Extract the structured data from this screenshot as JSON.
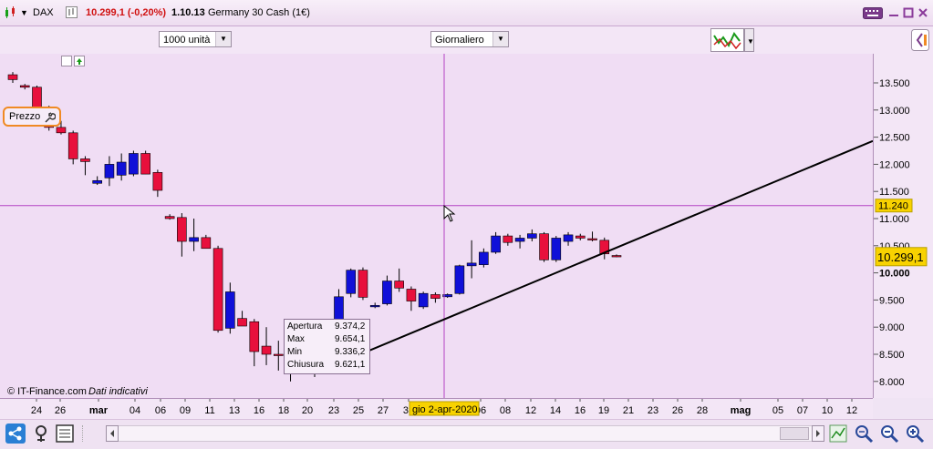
{
  "window": {
    "instrument": "DAX",
    "price_change": "10.299,1 (-0,20%)",
    "time": "1.10.13",
    "name": "Germany 30 Cash (1€)"
  },
  "toolbar": {
    "units_select": "1000 unità",
    "period_select": "Giornaliero"
  },
  "chart_panel": {
    "label": "Prezzo",
    "crosshair_price": "11.240",
    "current_price": "10.299,1",
    "crosshair_date": "gio 2-apr-2020",
    "source_credit": "© IT-Finance.com",
    "source_note": "Dati indicativi"
  },
  "tooltip": [
    {
      "key": "Apertura",
      "value": "9.374,2"
    },
    {
      "key": "Max",
      "value": "9.654,1"
    },
    {
      "key": "Min",
      "value": "9.336,2"
    },
    {
      "key": "Chiusura",
      "value": "9.621,1"
    }
  ],
  "colors": {
    "up": "#1010d8",
    "down": "#e8103c",
    "crosshair": "#b444c4",
    "price_tag": "#f8d200"
  },
  "chart_data": {
    "type": "candlestick",
    "ylim": [
      7700,
      14000
    ],
    "y_ticks": [
      "13.500",
      "13.000",
      "12.500",
      "12.000",
      "11.500",
      "11.000",
      "10.500",
      "10.000",
      "9.500",
      "9.000",
      "8.500",
      "8.000"
    ],
    "x_ticks": [
      "24",
      "26",
      "mar",
      "04",
      "06",
      "09",
      "11",
      "13",
      "16",
      "18",
      "20",
      "23",
      "25",
      "27",
      "30",
      "06",
      "08",
      "12",
      "14",
      "16",
      "19",
      "21",
      "23",
      "26",
      "28",
      "mag",
      "05",
      "07",
      "10",
      "12"
    ],
    "candles": [
      {
        "o": 13650,
        "h": 13700,
        "l": 13500,
        "c": 13560
      },
      {
        "o": 13450,
        "h": 13480,
        "l": 13380,
        "c": 13420
      },
      {
        "o": 13420,
        "h": 13450,
        "l": 13000,
        "c": 13030
      },
      {
        "o": 13030,
        "h": 13080,
        "l": 12620,
        "c": 12680
      },
      {
        "o": 12680,
        "h": 12800,
        "l": 12550,
        "c": 12580
      },
      {
        "o": 12580,
        "h": 12620,
        "l": 12000,
        "c": 12100
      },
      {
        "o": 12100,
        "h": 12150,
        "l": 11800,
        "c": 12050
      },
      {
        "o": 11650,
        "h": 11780,
        "l": 11620,
        "c": 11700
      },
      {
        "o": 11750,
        "h": 12150,
        "l": 11600,
        "c": 12000
      },
      {
        "o": 11800,
        "h": 12200,
        "l": 11700,
        "c": 12040
      },
      {
        "o": 11820,
        "h": 12250,
        "l": 11780,
        "c": 12200
      },
      {
        "o": 12200,
        "h": 12250,
        "l": 11820,
        "c": 11820
      },
      {
        "o": 11850,
        "h": 11900,
        "l": 11400,
        "c": 11520
      },
      {
        "o": 11040,
        "h": 11080,
        "l": 10980,
        "c": 11000
      },
      {
        "o": 11020,
        "h": 11100,
        "l": 10300,
        "c": 10580
      },
      {
        "o": 10580,
        "h": 11000,
        "l": 10400,
        "c": 10650
      },
      {
        "o": 10650,
        "h": 10700,
        "l": 10450,
        "c": 10450
      },
      {
        "o": 10450,
        "h": 10500,
        "l": 8900,
        "c": 8940
      },
      {
        "o": 8980,
        "h": 9820,
        "l": 8880,
        "c": 9650
      },
      {
        "o": 9160,
        "h": 9300,
        "l": 9020,
        "c": 9020
      },
      {
        "o": 9100,
        "h": 9150,
        "l": 8280,
        "c": 8550
      },
      {
        "o": 8650,
        "h": 9000,
        "l": 8300,
        "c": 8500
      },
      {
        "o": 8500,
        "h": 8750,
        "l": 8200,
        "c": 8480
      },
      {
        "o": 8480,
        "h": 8700,
        "l": 8000,
        "c": 8460
      },
      {
        "o": 8430,
        "h": 8500,
        "l": 8300,
        "c": 8470
      },
      {
        "o": 8200,
        "h": 8350,
        "l": 8080,
        "c": 8220
      },
      {
        "o": 8300,
        "h": 8760,
        "l": 8240,
        "c": 8620
      },
      {
        "o": 8980,
        "h": 9700,
        "l": 8920,
        "c": 9560
      },
      {
        "o": 9620,
        "h": 10080,
        "l": 9550,
        "c": 10050
      },
      {
        "o": 10050,
        "h": 10100,
        "l": 9500,
        "c": 9550
      },
      {
        "o": 9380,
        "h": 9450,
        "l": 9350,
        "c": 9400
      },
      {
        "o": 9430,
        "h": 9950,
        "l": 9400,
        "c": 9850
      },
      {
        "o": 9850,
        "h": 10080,
        "l": 9650,
        "c": 9720
      },
      {
        "o": 9700,
        "h": 9750,
        "l": 9300,
        "c": 9480
      },
      {
        "o": 9374,
        "h": 9654,
        "l": 9336,
        "c": 9621
      },
      {
        "o": 9600,
        "h": 9640,
        "l": 9450,
        "c": 9530
      },
      {
        "o": 9560,
        "h": 9620,
        "l": 9540,
        "c": 9600
      },
      {
        "o": 9620,
        "h": 10150,
        "l": 9600,
        "c": 10130
      },
      {
        "o": 10130,
        "h": 10600,
        "l": 9900,
        "c": 10180
      },
      {
        "o": 10150,
        "h": 10450,
        "l": 10100,
        "c": 10380
      },
      {
        "o": 10380,
        "h": 10750,
        "l": 10350,
        "c": 10680
      },
      {
        "o": 10680,
        "h": 10720,
        "l": 10500,
        "c": 10560
      },
      {
        "o": 10580,
        "h": 10700,
        "l": 10450,
        "c": 10640
      },
      {
        "o": 10640,
        "h": 10800,
        "l": 10580,
        "c": 10720
      },
      {
        "o": 10720,
        "h": 10750,
        "l": 10200,
        "c": 10240
      },
      {
        "o": 10240,
        "h": 10680,
        "l": 10200,
        "c": 10640
      },
      {
        "o": 10580,
        "h": 10750,
        "l": 10500,
        "c": 10700
      },
      {
        "o": 10680,
        "h": 10720,
        "l": 10600,
        "c": 10640
      },
      {
        "o": 10630,
        "h": 10760,
        "l": 10580,
        "c": 10620
      },
      {
        "o": 10600,
        "h": 10650,
        "l": 10250,
        "c": 10350
      },
      {
        "o": 10320,
        "h": 10340,
        "l": 10290,
        "c": 10299
      }
    ],
    "trendline": [
      {
        "x_index": 25,
        "y": 8150
      },
      {
        "x_index": "off-right",
        "y": 12430
      }
    ]
  }
}
